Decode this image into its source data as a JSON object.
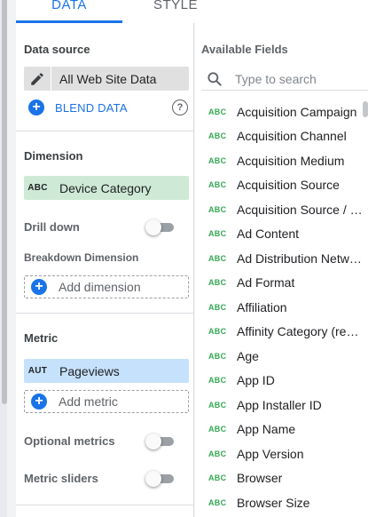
{
  "tabs": {
    "data": "DATA",
    "style": "STYLE"
  },
  "left_panel": {
    "data_source": {
      "title": "Data source",
      "name": "All Web Site Data",
      "blend_label": "BLEND DATA",
      "help_glyph": "?"
    },
    "dimension": {
      "title": "Dimension",
      "type": "ABC",
      "name": "Device Category"
    },
    "drill_down": {
      "label": "Drill down",
      "enabled": false
    },
    "breakdown": {
      "label": "Breakdown Dimension",
      "add_label": "Add dimension"
    },
    "metric": {
      "title": "Metric",
      "type": "AUT",
      "name": "Pageviews",
      "add_label": "Add metric"
    },
    "optional_metrics": {
      "label": "Optional metrics",
      "enabled": false
    },
    "metric_sliders": {
      "label": "Metric sliders",
      "enabled": false
    }
  },
  "right_panel": {
    "title": "Available Fields",
    "search_placeholder": "Type to search",
    "field_type": "ABC",
    "fields": [
      "Acquisition Campaign",
      "Acquisition Channel",
      "Acquisition Medium",
      "Acquisition Source",
      "Acquisition Source / Medium",
      "Ad Content",
      "Ad Distribution Network",
      "Ad Format",
      "Affiliation",
      "Affinity Category (reach)",
      "Age",
      "App ID",
      "App Installer ID",
      "App Name",
      "App Version",
      "Browser",
      "Browser Size"
    ]
  },
  "colors": {
    "accent": "#1a73e8",
    "dimension_chip": "#ceead6",
    "metric_chip": "#c6e1fb",
    "field_type_green": "#34a853"
  },
  "icons": {
    "edit": "pencil-icon",
    "add": "plus-circle-icon",
    "help": "help-circle-icon",
    "search": "search-icon"
  }
}
